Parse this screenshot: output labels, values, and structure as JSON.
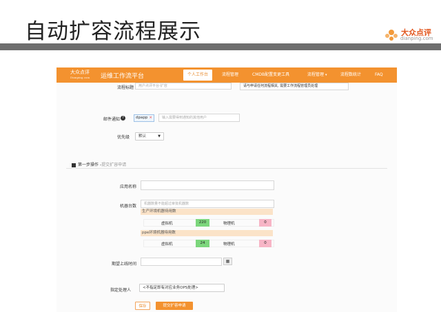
{
  "slide": {
    "title": "自动扩容流程展示",
    "brand_cn": "大众点评",
    "brand_en": "dianping.com"
  },
  "app": {
    "logo_cn": "大众点评",
    "logo_en": "Dianping.com",
    "title": "运维工作流平台",
    "nav": [
      {
        "label": "个人工作台",
        "active": true
      },
      {
        "label": "流程管理",
        "active": false
      },
      {
        "label": "CMDB配置变更工具",
        "active": false
      },
      {
        "label": "流程管理",
        "active": false,
        "caret": "▾"
      },
      {
        "label": "流程数统计",
        "active": false
      },
      {
        "label": "FAQ",
        "active": false
      }
    ],
    "colors": {
      "accent": "#f3922f",
      "green": "#7cd67c",
      "pink": "#f7b5c6",
      "env_bar": "#fbe3c8"
    }
  },
  "form": {
    "process_title_label": "流程标题",
    "process_title_placeholder": "用户点评平台-扩容",
    "process_title_hint": "请与申请任何流程相关, 需要工作流程管理员处理",
    "email_label": "邮件通知",
    "email_tag": "dpapp",
    "email_placeholder": "输入需要得到通知的其他用户",
    "priority_label": "优先级",
    "priority_value": "默认",
    "section_title": "第一步操作 -",
    "section_sub": "提交扩容申请",
    "app_name_label": "应用名称",
    "machine_count_label": "机器台数",
    "machine_count_placeholder": "机器数量不能超过审批机器数",
    "prod_env_label": "生产环境机器待用数",
    "ppe_env_label": "ppe环境机器待用数",
    "vm_label": "虚拟机",
    "pm_label": "物理机",
    "prod_vm": "220",
    "prod_pm": "0",
    "ppe_vm": "24",
    "ppe_pm": "0",
    "online_time_label": "期望上线时间",
    "calendar_icon": "calendar-icon",
    "handler_label": "指定处理人",
    "handler_value": "<不指定即有对应业务OPS处理>",
    "save_label": "保存",
    "submit_label": "提交扩容申请"
  }
}
